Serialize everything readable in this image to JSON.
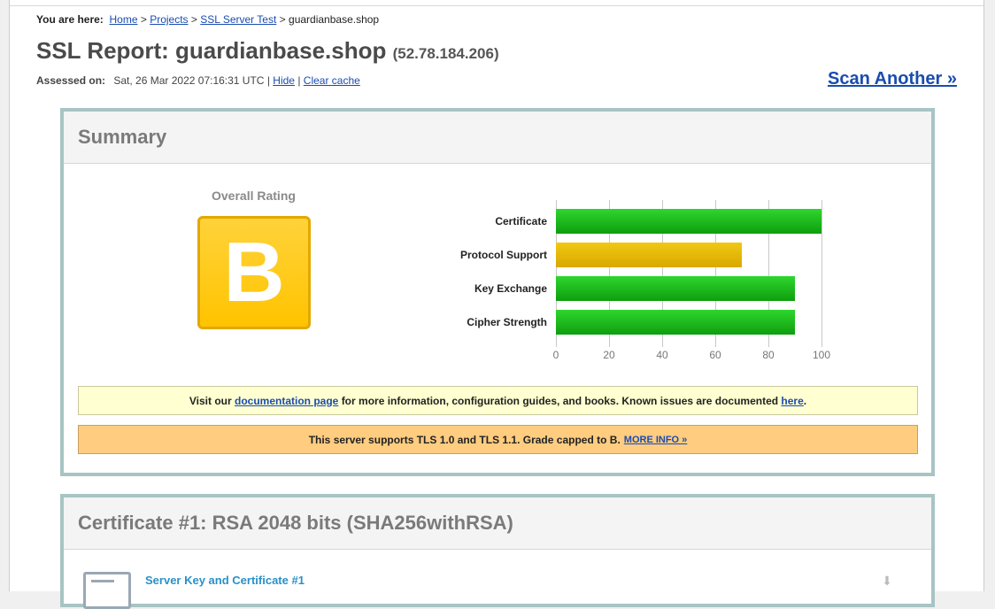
{
  "breadcrumb": {
    "prefix": "You are here:",
    "home": "Home",
    "projects": "Projects",
    "ssl_test": "SSL Server Test",
    "current": "guardianbase.shop",
    "separator": ">"
  },
  "report": {
    "title": "SSL Report: guardianbase.shop",
    "ip": "(52.78.184.206)",
    "assessed_label": "Assessed on:",
    "assessed_value": "Sat, 26 Mar 2022 07:16:31 UTC",
    "pipe": "|",
    "hide": "Hide",
    "clear_cache": "Clear cache",
    "scan_another": "Scan Another »"
  },
  "summary": {
    "heading": "Summary",
    "overall_label": "Overall Rating",
    "grade": "B",
    "grade_color": "#ffc400",
    "info_text_1": "Visit our",
    "info_link_doc": "documentation page",
    "info_text_2": "for more information, configuration guides, and books. Known issues are documented",
    "info_link_here": "here",
    "info_text_3": ".",
    "warn_text": "This server supports TLS 1.0 and TLS 1.1. Grade capped to B.",
    "warn_link": "MORE INFO »"
  },
  "chart_data": {
    "type": "bar",
    "orientation": "horizontal",
    "categories": [
      "Certificate",
      "Protocol Support",
      "Key Exchange",
      "Cipher Strength"
    ],
    "values": [
      100,
      70,
      90,
      90
    ],
    "colors": [
      "#1cb81c",
      "#e8bc0a",
      "#1cb81c",
      "#1cb81c"
    ],
    "xlim": [
      0,
      100
    ],
    "ticks": [
      0,
      20,
      40,
      60,
      80,
      100
    ],
    "grid": true
  },
  "certificate": {
    "heading": "Certificate #1: RSA 2048 bits (SHA256withRSA)",
    "link": "Server Key and Certificate #1",
    "icon": "certificate-icon",
    "download_icon": "download-icon"
  }
}
